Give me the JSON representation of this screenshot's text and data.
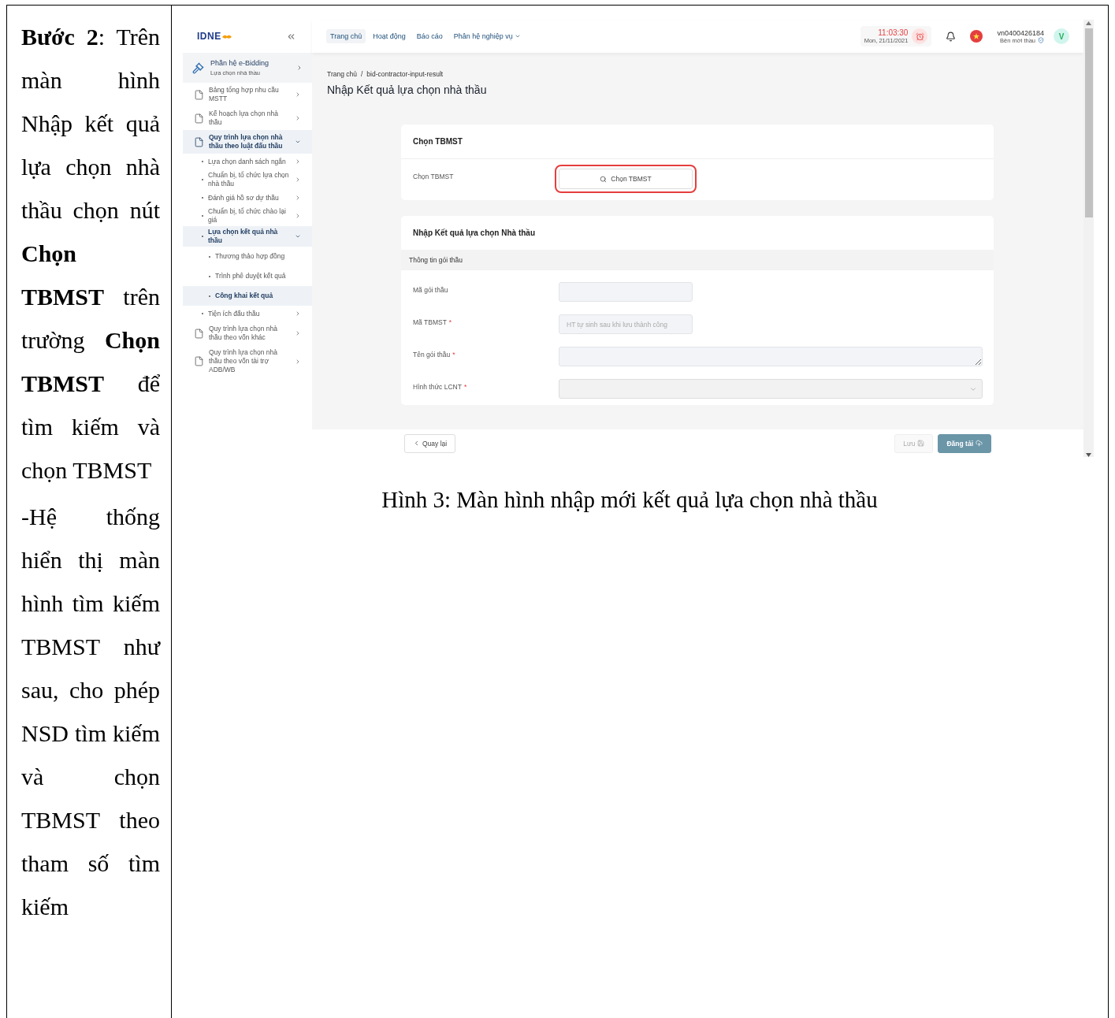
{
  "instructions": {
    "paragraphs": [
      "**Bước 2**: Trên màn hình Nhập kết quả lựa chọn nhà thầu chọn nút **Chọn TBMST** trên trường **Chọn TBMST** để tìm kiếm và chọn TBMST",
      "-Hệ thống hiển thị màn hình tìm kiếm TBMST như sau, cho phép NSD tìm kiếm và chọn TBMST theo tham số tìm kiếm"
    ]
  },
  "screenshot": {
    "logo": "IDNE",
    "module": {
      "title": "Phần hệ e-Bidding",
      "subtitle": "Lựa chọn nhà thầu"
    },
    "sidebar": {
      "items": [
        {
          "label": "Bảng tổng hợp nhu cầu MSTT",
          "kind": "page",
          "selected": false,
          "expanded": false
        },
        {
          "label": "Kế hoạch lựa chọn nhà thầu",
          "kind": "page",
          "selected": false,
          "expanded": false
        },
        {
          "label": "Quy trình lựa chọn nhà thầu theo luật đấu thầu",
          "kind": "page",
          "selected": true,
          "expanded": true,
          "children": [
            {
              "label": "Lựa chọn danh sách ngắn",
              "kind": "group",
              "selected": false,
              "expanded": false
            },
            {
              "label": "Chuẩn bị, tổ chức lựa chọn nhà thầu",
              "kind": "group",
              "selected": false,
              "expanded": false
            },
            {
              "label": "Đánh giá hồ sơ dự thầu",
              "kind": "group",
              "selected": false,
              "expanded": false
            },
            {
              "label": "Chuẩn bị, tổ chức chào lại giá",
              "kind": "group",
              "selected": false,
              "expanded": false
            },
            {
              "label": "Lựa chọn kết quả nhà thầu",
              "kind": "group",
              "selected": true,
              "expanded": true,
              "children": [
                {
                  "label": "Thương thảo hợp đồng",
                  "kind": "leaf",
                  "selected": false
                },
                {
                  "label": "Trình phê duyệt kết quả",
                  "kind": "leaf",
                  "selected": false
                },
                {
                  "label": "Công khai kết quả",
                  "kind": "leaf",
                  "selected": true
                }
              ]
            },
            {
              "label": "Tiện ích đấu thầu",
              "kind": "group",
              "selected": false,
              "expanded": false
            }
          ]
        },
        {
          "label": "Quy trình lựa chọn nhà thầu theo vốn khác",
          "kind": "page",
          "selected": false,
          "expanded": false
        },
        {
          "label": "Quy trình lựa chọn nhà thầu theo vốn tài trợ ADB/WB",
          "kind": "page",
          "selected": false,
          "expanded": false
        }
      ]
    },
    "nav": [
      {
        "label": "Trang chủ",
        "selected": true,
        "dropdown": false
      },
      {
        "label": "Hoạt động",
        "selected": false,
        "dropdown": false
      },
      {
        "label": "Báo cáo",
        "selected": false,
        "dropdown": false
      },
      {
        "label": "Phân hệ nghiệp vụ",
        "selected": false,
        "dropdown": true
      }
    ],
    "clock": {
      "time": "11:03:30",
      "date": "Mon, 21/11/2021"
    },
    "user": {
      "name": "vn0400426184",
      "role": "Bên mời thầu",
      "avatar": "V"
    },
    "breadcrumb": {
      "separator": "/",
      "items": [
        "Trang chủ",
        "bid-contractor-input-result"
      ]
    },
    "page_title": "Nhập Kết quả lựa chọn nhà thầu",
    "select_card": {
      "title": "Chọn TBMST",
      "label": "Chọn TBMST",
      "button": "Chọn TBMST"
    },
    "form_card": {
      "title": "Nhập Kết quả lựa chọn Nhà thầu",
      "section": "Thông tin gói thầu",
      "fields": [
        {
          "label": "Mã gói thầu",
          "kind": "input"
        },
        {
          "label": "Mã TBMST",
          "kind": "input",
          "required_mark": "*",
          "placeholder": "HT tự sinh sau khi lưu thành công"
        },
        {
          "label": "Tên gói thầu",
          "kind": "textarea",
          "required_mark": "*"
        },
        {
          "label": "Hình thức LCNT",
          "kind": "select",
          "required_mark": "*"
        }
      ]
    },
    "footer": {
      "back": "Quay lại",
      "save": "Lưu",
      "publish": "Đăng tải"
    }
  },
  "caption": "Hình 3: Màn hình nhập mới kết quả lựa chọn nhà thầu"
}
